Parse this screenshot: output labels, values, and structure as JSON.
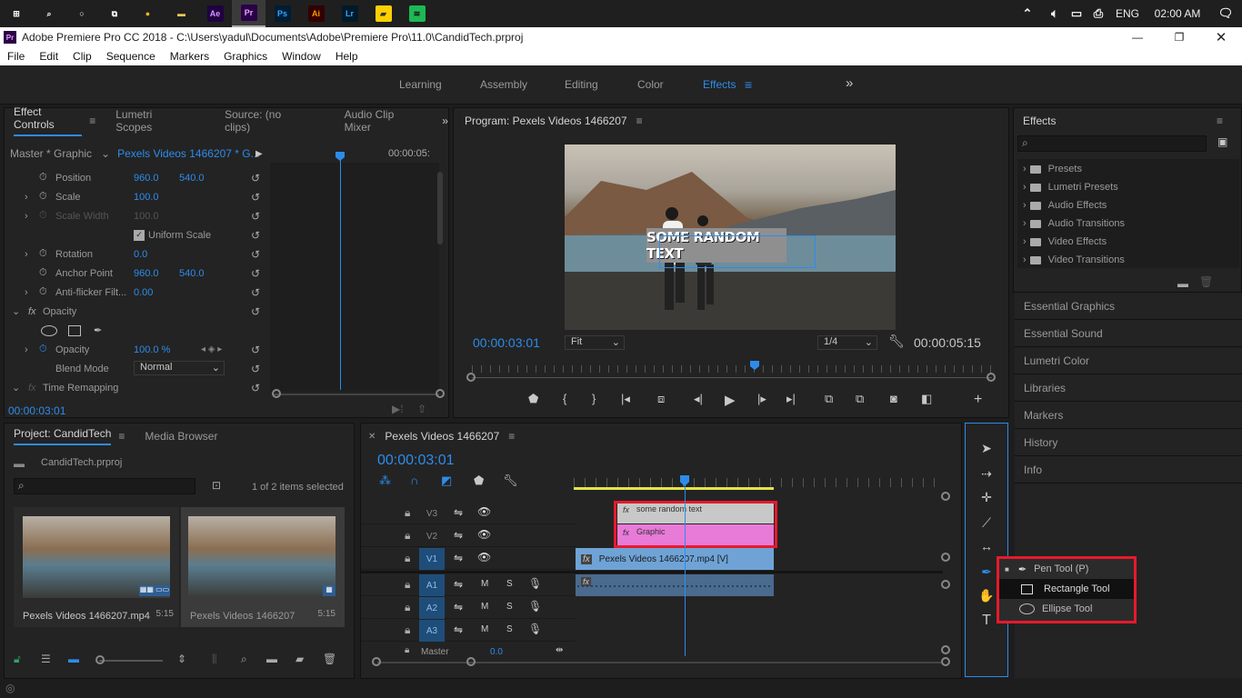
{
  "taskbar": {
    "apps": [
      {
        "name": "windows-start-icon",
        "glyph": "⊞",
        "bg": "",
        "color": "#fff"
      },
      {
        "name": "search-icon",
        "glyph": "⌕",
        "bg": "",
        "color": "#fff"
      },
      {
        "name": "cortana-icon",
        "glyph": "○",
        "bg": "",
        "color": "#fff"
      },
      {
        "name": "task-view-icon",
        "glyph": "⧉",
        "bg": "",
        "color": "#fff"
      },
      {
        "name": "chrome-icon",
        "glyph": "●",
        "bg": "",
        "color": "#e6b426"
      },
      {
        "name": "file-explorer-icon",
        "glyph": "▬",
        "bg": "",
        "color": "#f2c94c"
      },
      {
        "name": "after-effects-icon",
        "glyph": "Ae",
        "bg": "#1f0040",
        "color": "#d49bff"
      },
      {
        "name": "premiere-icon",
        "glyph": "Pr",
        "bg": "#2a0046",
        "color": "#e7a3ff"
      },
      {
        "name": "photoshop-icon",
        "glyph": "Ps",
        "bg": "#001d34",
        "color": "#31a8ff"
      },
      {
        "name": "illustrator-icon",
        "glyph": "Ai",
        "bg": "#330000",
        "color": "#ff9a00"
      },
      {
        "name": "lightroom-icon",
        "glyph": "Lr",
        "bg": "#001a29",
        "color": "#31a8ff"
      },
      {
        "name": "sticky-notes-icon",
        "glyph": "▰",
        "bg": "#ffd000",
        "color": "#333"
      },
      {
        "name": "spotify-icon",
        "glyph": "≋",
        "bg": "#1db954",
        "color": "#111"
      }
    ],
    "lang": "ENG",
    "time": "02:00 AM"
  },
  "window": {
    "title": "Adobe Premiere Pro CC 2018 - C:\\Users\\yadul\\Documents\\Adobe\\Premiere Pro\\11.0\\CandidTech.prproj"
  },
  "menu": [
    "File",
    "Edit",
    "Clip",
    "Sequence",
    "Markers",
    "Graphics",
    "Window",
    "Help"
  ],
  "workspaces": [
    "Learning",
    "Assembly",
    "Editing",
    "Color",
    "Effects"
  ],
  "effect_controls": {
    "tabs": [
      "Effect Controls",
      "Lumetri Scopes",
      "Source: (no clips)",
      "Audio Clip Mixer"
    ],
    "master": "Master * Graphic",
    "clip": "Pexels Videos 1466207 * G...",
    "timecode_head": "00:00:05:",
    "rows": [
      {
        "label": "Position",
        "v1": "960.0",
        "v2": "540.0"
      },
      {
        "label": "Scale",
        "v1": "100.0",
        "v2": ""
      },
      {
        "label": "Scale Width",
        "v1": "100.0",
        "v2": ""
      },
      {
        "label": "Uniform Scale",
        "v1": "",
        "v2": ""
      },
      {
        "label": "Rotation",
        "v1": "0.0",
        "v2": ""
      },
      {
        "label": "Anchor Point",
        "v1": "960.0",
        "v2": "540.0"
      },
      {
        "label": "Anti-flicker Filt...",
        "v1": "0.00",
        "v2": ""
      },
      {
        "label": "Opacity",
        "v1": "",
        "v2": ""
      },
      {
        "label": "Opacity",
        "v1": "100.0 %",
        "v2": ""
      },
      {
        "label": "Blend Mode",
        "v1": "Normal",
        "v2": ""
      },
      {
        "label": "Time Remapping",
        "v1": "",
        "v2": ""
      }
    ],
    "timecode": "00:00:03:01"
  },
  "program": {
    "title": "Program: Pexels Videos 1466207",
    "overlay_text": "SOME RANDOM TEXT",
    "timecode": "00:00:03:01",
    "fit": "Fit",
    "quality": "1/4",
    "duration": "00:00:05:15"
  },
  "effects_panel": {
    "title": "Effects",
    "items": [
      "Presets",
      "Lumetri Presets",
      "Audio Effects",
      "Audio Transitions",
      "Video Effects",
      "Video Transitions"
    ],
    "collapsed": [
      "Essential Graphics",
      "Essential Sound",
      "Lumetri Color",
      "Libraries",
      "Markers",
      "History",
      "Info"
    ]
  },
  "project": {
    "tabs": [
      "Project: CandidTech",
      "Media Browser"
    ],
    "file": "CandidTech.prproj",
    "selected": "1 of 2 items selected",
    "items": [
      {
        "name": "Pexels Videos 1466207.mp4",
        "dur": "5:15"
      },
      {
        "name": "Pexels Videos 1466207",
        "dur": "5:15"
      }
    ]
  },
  "timeline": {
    "title": "Pexels Videos 1466207",
    "timecode": "00:00:03:01",
    "video_tracks": [
      "V3",
      "V2",
      "V1"
    ],
    "audio_tracks": [
      "A1",
      "A2",
      "A3"
    ],
    "master": "Master",
    "master_val": "0.0",
    "clips": {
      "v3": "some random text",
      "v2": "Graphic",
      "v1": "Pexels Videos 1466207.mp4 [V]"
    },
    "m_label": "M",
    "s_label": "S"
  },
  "tools_popup": [
    "Pen Tool (P)",
    "Rectangle Tool",
    "Ellipse Tool"
  ],
  "colors": {
    "accent": "#2d8ceb",
    "highlight": "#e8192c",
    "pink": "#e87ad8",
    "clip_blue": "#6fa3d6"
  }
}
